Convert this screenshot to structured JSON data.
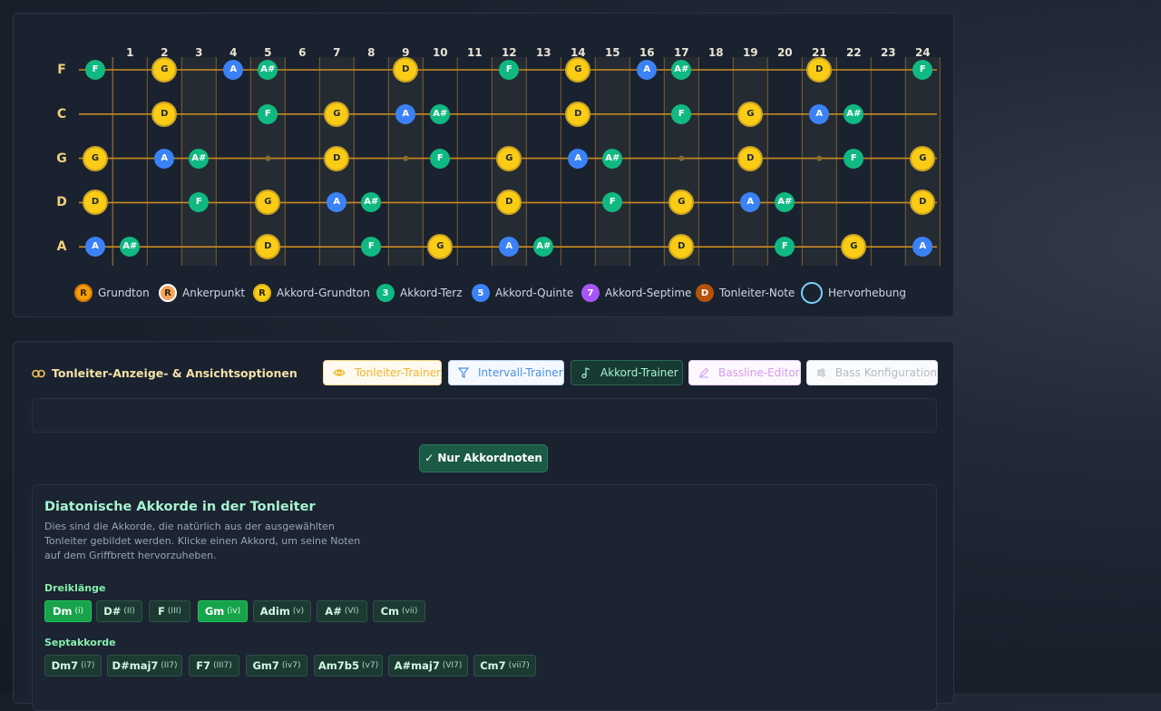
{
  "fretboard": {
    "fret_numbers": [
      "1",
      "2",
      "3",
      "4",
      "5",
      "6",
      "7",
      "8",
      "9",
      "10",
      "11",
      "12",
      "13",
      "14",
      "15",
      "16",
      "17",
      "18",
      "19",
      "20",
      "21",
      "22",
      "23",
      "24"
    ],
    "strings": [
      {
        "name": "F",
        "notes": [
          {
            "fret": 0,
            "label": "F",
            "role": "terz"
          },
          {
            "fret": 2,
            "label": "G",
            "role": "root"
          },
          {
            "fret": 4,
            "label": "A",
            "role": "quinte"
          },
          {
            "fret": 5,
            "label": "A#",
            "role": "terz"
          },
          {
            "fret": 9,
            "label": "D",
            "role": "root"
          },
          {
            "fret": 12,
            "label": "F",
            "role": "terz"
          },
          {
            "fret": 14,
            "label": "G",
            "role": "root"
          },
          {
            "fret": 16,
            "label": "A",
            "role": "quinte"
          },
          {
            "fret": 17,
            "label": "A#",
            "role": "terz"
          },
          {
            "fret": 21,
            "label": "D",
            "role": "root"
          },
          {
            "fret": 24,
            "label": "F",
            "role": "terz"
          }
        ]
      },
      {
        "name": "C",
        "notes": [
          {
            "fret": 2,
            "label": "D",
            "role": "root"
          },
          {
            "fret": 5,
            "label": "F",
            "role": "terz"
          },
          {
            "fret": 7,
            "label": "G",
            "role": "root"
          },
          {
            "fret": 9,
            "label": "A",
            "role": "quinte"
          },
          {
            "fret": 10,
            "label": "A#",
            "role": "terz"
          },
          {
            "fret": 14,
            "label": "D",
            "role": "root"
          },
          {
            "fret": 17,
            "label": "F",
            "role": "terz"
          },
          {
            "fret": 19,
            "label": "G",
            "role": "root"
          },
          {
            "fret": 21,
            "label": "A",
            "role": "quinte"
          },
          {
            "fret": 22,
            "label": "A#",
            "role": "terz"
          }
        ]
      },
      {
        "name": "G",
        "notes": [
          {
            "fret": 0,
            "label": "G",
            "role": "root"
          },
          {
            "fret": 2,
            "label": "A",
            "role": "quinte"
          },
          {
            "fret": 3,
            "label": "A#",
            "role": "terz"
          },
          {
            "fret": 7,
            "label": "D",
            "role": "root"
          },
          {
            "fret": 10,
            "label": "F",
            "role": "terz"
          },
          {
            "fret": 12,
            "label": "G",
            "role": "root"
          },
          {
            "fret": 14,
            "label": "A",
            "role": "quinte"
          },
          {
            "fret": 15,
            "label": "A#",
            "role": "terz"
          },
          {
            "fret": 19,
            "label": "D",
            "role": "root"
          },
          {
            "fret": 22,
            "label": "F",
            "role": "terz"
          },
          {
            "fret": 24,
            "label": "G",
            "role": "root"
          }
        ]
      },
      {
        "name": "D",
        "notes": [
          {
            "fret": 0,
            "label": "D",
            "role": "root"
          },
          {
            "fret": 3,
            "label": "F",
            "role": "terz"
          },
          {
            "fret": 5,
            "label": "G",
            "role": "root"
          },
          {
            "fret": 7,
            "label": "A",
            "role": "quinte"
          },
          {
            "fret": 8,
            "label": "A#",
            "role": "terz"
          },
          {
            "fret": 12,
            "label": "D",
            "role": "root"
          },
          {
            "fret": 15,
            "label": "F",
            "role": "terz"
          },
          {
            "fret": 17,
            "label": "G",
            "role": "root"
          },
          {
            "fret": 19,
            "label": "A",
            "role": "quinte"
          },
          {
            "fret": 20,
            "label": "A#",
            "role": "terz"
          },
          {
            "fret": 24,
            "label": "D",
            "role": "root"
          }
        ]
      },
      {
        "name": "A",
        "notes": [
          {
            "fret": 0,
            "label": "A",
            "role": "quinte"
          },
          {
            "fret": 1,
            "label": "A#",
            "role": "terz"
          },
          {
            "fret": 5,
            "label": "D",
            "role": "root"
          },
          {
            "fret": 8,
            "label": "F",
            "role": "terz"
          },
          {
            "fret": 10,
            "label": "G",
            "role": "root"
          },
          {
            "fret": 12,
            "label": "A",
            "role": "quinte"
          },
          {
            "fret": 13,
            "label": "A#",
            "role": "terz"
          },
          {
            "fret": 17,
            "label": "D",
            "role": "root"
          },
          {
            "fret": 20,
            "label": "F",
            "role": "terz"
          },
          {
            "fret": 22,
            "label": "G",
            "role": "root"
          },
          {
            "fret": 24,
            "label": "A",
            "role": "quinte"
          }
        ]
      }
    ],
    "inlay_frets": [
      3,
      5,
      7,
      9,
      12,
      15,
      17,
      19,
      21,
      24
    ]
  },
  "legend": [
    {
      "symbol": "R",
      "label": "Grundton",
      "style": "grundton"
    },
    {
      "symbol": "R",
      "label": "Ankerpunkt",
      "style": "anker"
    },
    {
      "symbol": "R",
      "label": "Akkord-Grundton",
      "style": "akkord-grundton"
    },
    {
      "symbol": "3",
      "label": "Akkord-Terz",
      "style": "terz"
    },
    {
      "symbol": "5",
      "label": "Akkord-Quinte",
      "style": "quinte"
    },
    {
      "symbol": "7",
      "label": "Akkord-Septime",
      "style": "septime"
    },
    {
      "symbol": "D",
      "label": "Tonleiter-Note",
      "style": "tonleiter"
    },
    {
      "symbol": "",
      "label": "Hervorhebung",
      "style": "hervorhebung"
    }
  ],
  "colors": {
    "root": "#facc15",
    "terz": "#10b981",
    "quinte": "#3b82f6",
    "septime": "#a855f7",
    "grundton": "#f59e0b",
    "tonleiter_note": "#b45309",
    "string": "#c98a1f",
    "fret": "#8a6a30"
  },
  "options": {
    "title": "Tonleiter-Anzeige- & Ansichtsoptionen",
    "trainer_buttons": [
      {
        "label": "Tonleiter-Trainer",
        "icon": "eye-icon"
      },
      {
        "label": "Intervall-Trainer",
        "icon": "filter-icon"
      },
      {
        "label": "Akkord-Trainer",
        "icon": "music-note-icon"
      },
      {
        "label": "Bassline-Editor",
        "icon": "pencil-icon"
      },
      {
        "label": "Bass Konfiguration",
        "icon": "sliders-icon"
      }
    ],
    "only_chord_notes": "✓ Nur Akkordnoten"
  },
  "chords": {
    "title": "Diatonische Akkorde in der Tonleiter",
    "description": "Dies sind die Akkorde, die natürlich aus der ausgewählten Tonleiter gebildet werden. Klicke einen Akkord, um seine Noten auf dem Griffbrett hervorzuheben.",
    "triads_label": "Dreiklänge",
    "triads": [
      {
        "name": "Dm",
        "degree": "(i)",
        "selected": true
      },
      {
        "name": "D#",
        "degree": "(II)",
        "selected": false
      },
      {
        "name": "F",
        "degree": "(III)",
        "selected": false
      },
      {
        "name": "Gm",
        "degree": "(iv)",
        "selected": true
      },
      {
        "name": "Adim",
        "degree": "(v)",
        "selected": false
      },
      {
        "name": "A#",
        "degree": "(VI)",
        "selected": false
      },
      {
        "name": "Cm",
        "degree": "(vii)",
        "selected": false
      }
    ],
    "sevenths_label": "Septakkorde",
    "sevenths": [
      {
        "name": "Dm7",
        "degree": "(i7)",
        "selected": false
      },
      {
        "name": "D#maj7",
        "degree": "(II7)",
        "selected": false
      },
      {
        "name": "F7",
        "degree": "(III7)",
        "selected": false
      },
      {
        "name": "Gm7",
        "degree": "(iv7)",
        "selected": false
      },
      {
        "name": "Am7b5",
        "degree": "(v7)",
        "selected": false
      },
      {
        "name": "A#maj7",
        "degree": "(VI7)",
        "selected": false
      },
      {
        "name": "Cm7",
        "degree": "(vii7)",
        "selected": false
      }
    ]
  }
}
